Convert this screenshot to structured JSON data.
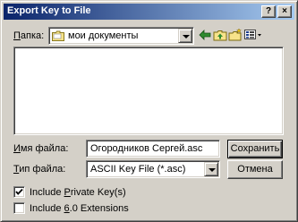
{
  "window": {
    "title": "Export Key to File",
    "help_button": "?",
    "close_button": "×"
  },
  "look_in": {
    "label_accel": "П",
    "label_rest": "апка:",
    "value": "мои документы"
  },
  "toolbar_icons": [
    "back-arrow-icon",
    "up-folder-icon",
    "new-folder-icon",
    "view-menu-icon"
  ],
  "file_name": {
    "label_pre": "",
    "label_accel": "И",
    "label_rest": "мя файла:",
    "value": "Огородников Сергей.asc"
  },
  "file_type": {
    "label_accel": "Т",
    "label_rest": "ип файла:",
    "value": "ASCII Key File (*.asc)"
  },
  "buttons": {
    "save": "Сохранить",
    "cancel": "Отмена"
  },
  "options": {
    "include_private_pre": "Include ",
    "include_private_accel": "P",
    "include_private_rest": "rivate Key(s)",
    "include_private_checked": true,
    "include_60_pre": "Include ",
    "include_60_accel": "6",
    "include_60_rest": ".0 Extensions",
    "include_60_checked": false
  },
  "colors": {
    "face": "#d4d0c8",
    "title_start": "#0a246a",
    "title_end": "#a6caf0",
    "folder_yellow": "#f7e38a",
    "accent_green": "#2e8b2e"
  }
}
